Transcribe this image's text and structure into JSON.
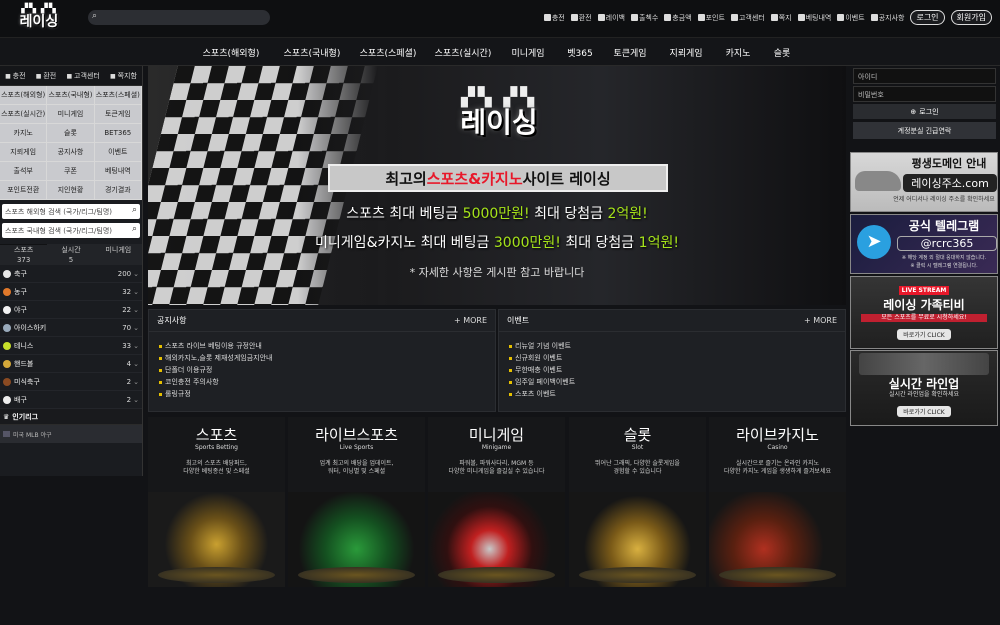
{
  "site": {
    "logo_text": "레이싱"
  },
  "top_links": [
    {
      "icon": "coin-icon",
      "label": "충전"
    },
    {
      "icon": "exchange-icon",
      "label": "환전"
    },
    {
      "icon": "monitor-icon",
      "label": "레이백"
    },
    {
      "icon": "calendar-icon",
      "label": "출첵수"
    },
    {
      "icon": "money-icon",
      "label": "충금액"
    },
    {
      "icon": "point-icon",
      "label": "포인트"
    },
    {
      "icon": "support-icon",
      "label": "고객센터"
    },
    {
      "icon": "mail-icon",
      "label": "쪽지"
    },
    {
      "icon": "list-icon",
      "label": "베팅내역"
    },
    {
      "icon": "event-icon",
      "label": "이벤트"
    },
    {
      "icon": "notice-icon",
      "label": "공지사항"
    }
  ],
  "auth": {
    "login": "로그인",
    "signup": "회원가입"
  },
  "nav": [
    "스포츠(해외형)",
    "스포츠(국내형)",
    "스포츠(스페셜)",
    "스포츠(실시간)",
    "미니게임",
    "벳365",
    "토큰게임",
    "지뢰게임",
    "카지노",
    "슬롯"
  ],
  "sidebar": {
    "top": [
      "충전",
      "환전",
      "고객센터",
      "쪽지함"
    ],
    "grid": [
      "스포츠(해외형)",
      "스포츠(국내형)",
      "스포츠(스페셜)",
      "스포츠(실시간)",
      "미니게임",
      "토큰게임",
      "카지노",
      "슬롯",
      "BET365",
      "지뢰게임",
      "공지사항",
      "이벤트",
      "출석부",
      "쿠폰",
      "베팅내역",
      "포인트전환",
      "지인현황",
      "경기결과"
    ],
    "search1": "스포츠 해외형 검색 (국가/리그/팀명)",
    "search2": "스포츠 국내형 검색 (국가/리그/팀명)",
    "tabs": [
      {
        "label": "스포츠",
        "count": "373"
      },
      {
        "label": "실시간",
        "count": "5"
      },
      {
        "label": "미니게임",
        "count": ""
      }
    ],
    "sports": [
      {
        "name": "축구",
        "count": "200",
        "color": "#e8e8e8"
      },
      {
        "name": "농구",
        "count": "32",
        "color": "#e0782a"
      },
      {
        "name": "야구",
        "count": "22",
        "color": "#f2f2f2"
      },
      {
        "name": "아이스하키",
        "count": "70",
        "color": "#9ab"
      },
      {
        "name": "테니스",
        "count": "33",
        "color": "#c8e02a"
      },
      {
        "name": "핸드볼",
        "count": "4",
        "color": "#d4a83a"
      },
      {
        "name": "미식축구",
        "count": "2",
        "color": "#8a4a22"
      },
      {
        "name": "배구",
        "count": "2",
        "color": "#eee"
      }
    ],
    "popular_title": "인기리그",
    "popular": [
      "미국 MLB 야구"
    ]
  },
  "banner": {
    "logo": "레이싱",
    "headline_pre": "최고의 ",
    "headline_red": "스포츠&카지노",
    "headline_post": " 사이트 레이싱",
    "line1_a": "스포츠 최대 베팅금 ",
    "line1_b": "5000만원!",
    "line1_c": " 최대 당첨금 ",
    "line1_d": "2억원!",
    "line2_a": "미니게임&카지노 최대 베팅금 ",
    "line2_b": "3000만원!",
    "line2_c": " 최대 당첨금 ",
    "line2_d": "1억원!",
    "note": "* 자세한 사항은 게시판 참고 바랍니다"
  },
  "login": {
    "id": "아이디",
    "pw": "비밀번호",
    "login": "로그인",
    "recover": "계정분실 긴급연락"
  },
  "ads": {
    "ad1_title": "평생도메인 안내",
    "ad1_domain": "레이싱주소.com",
    "ad1_sub": "언제 어디서나 레이싱 주소를 확인하세요",
    "ad2_title": "공식 텔레그램",
    "ad2_handle": "@rcrc365",
    "ad2_sub1": "※ 해당 계정 외 절대 응대하지 않습니다.",
    "ad2_sub2": "※ 클릭 시 텔레그램 연결됩니다.",
    "ad3_live": "LIVE STREAM",
    "ad3_title": "레이싱 가족티비",
    "ad3_sub": "모든 스포츠를 무료로 시청하세요!",
    "ad3_btn": "바로가기 CLICK",
    "ad4_title": "실시간 라인업",
    "ad4_sub": "실시간 라인업을 확인하세요",
    "ad4_btn": "바로가기 CLICK"
  },
  "notice": {
    "title": "공지사항",
    "more": "MORE",
    "items": [
      "스포츠 라이브 베팅이용 규정안내",
      "해외카지노,슬롯 제재성게임금지안내",
      "단폴더 이용규정",
      "코인충전 주의사항",
      "롤링규정"
    ]
  },
  "events": {
    "title": "이벤트",
    "more": "MORE",
    "items": [
      "리뉴얼 기념 이벤트",
      "신규회원 이벤트",
      "무한매충 이벤트",
      "임주일 페이백이벤트",
      "스포츠 이벤트"
    ]
  },
  "games": [
    {
      "title": "스포츠",
      "sub": "Sports Betting",
      "d1": "최고의 스포츠 배당퍼드,",
      "d2": "다양한 베팅종선 및 스페셜"
    },
    {
      "title": "라이브스포츠",
      "sub": "Live Sports",
      "d1": "업계 최고의 배당을 업데이트,",
      "d2": "워터, 이닝별 및 스페셜"
    },
    {
      "title": "미니게임",
      "sub": "Minigame",
      "d1": "파워볼, 파워사다리, MGM 등",
      "d2": "다양한 미니게임을 즐길실 수 있습니다"
    },
    {
      "title": "슬롯",
      "sub": "Slot",
      "d1": "뛰어난 그래픽, 다양한 슬롯게임을",
      "d2": "경험할 수 있습니다"
    },
    {
      "title": "라이브카지노",
      "sub": "Casino",
      "d1": "실시간으로 즐기는 온라인 카지노",
      "d2": "다양한 카지노 게임을 생생하게 즐겨보세요"
    }
  ],
  "colors": {
    "accent_green": "#a6e41a",
    "accent_red": "#e8182a",
    "bullet": "#e6c000",
    "tab_active": "#1b6ee8"
  }
}
